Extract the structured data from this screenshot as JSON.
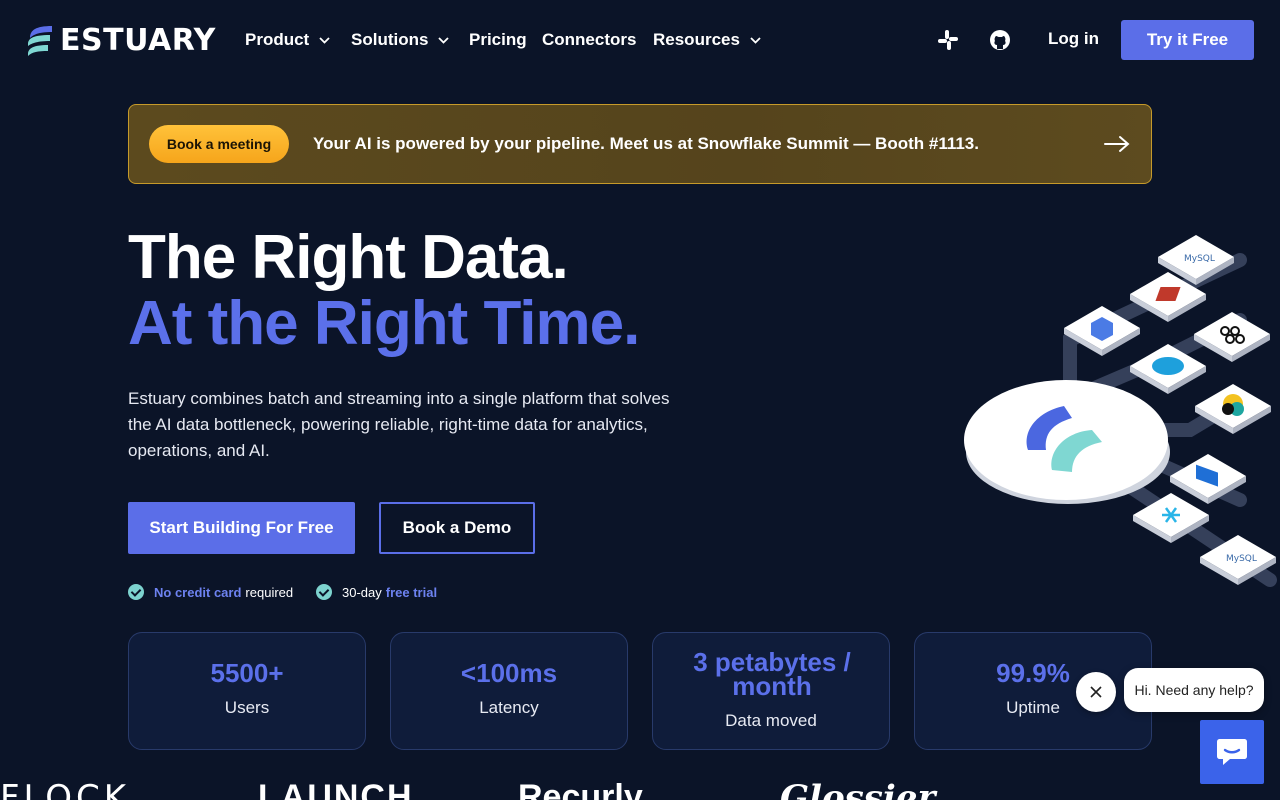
{
  "brand": {
    "name": "ESTUARY"
  },
  "nav": {
    "items": [
      {
        "label": "Product",
        "has_dropdown": true
      },
      {
        "label": "Solutions",
        "has_dropdown": true
      },
      {
        "label": "Pricing",
        "has_dropdown": false
      },
      {
        "label": "Connectors",
        "has_dropdown": false
      },
      {
        "label": "Resources",
        "has_dropdown": true
      }
    ],
    "icons": [
      "slack-icon",
      "github-icon"
    ],
    "login": "Log in",
    "cta": "Try it Free"
  },
  "banner": {
    "button": "Book a meeting",
    "text": "Your AI is powered by your pipeline. Meet us at Snowflake Summit — Booth #1113.",
    "icon": "arrow-right-icon"
  },
  "hero": {
    "title_line1": "The Right Data.",
    "title_line2": "At the Right Time.",
    "description": "Estuary combines batch and streaming into a single platform that solves the AI data bottleneck, powering reliable, right-time data for analytics, operations, and AI.",
    "primary_cta": "Start Building For Free",
    "secondary_cta": "Book a Demo",
    "perks": [
      {
        "highlight": "No credit card",
        "rest": "required",
        "order": "highlight-first"
      },
      {
        "lead": "30-day",
        "highlight": "free trial",
        "order": "highlight-last"
      }
    ]
  },
  "stats": [
    {
      "value": "5500+",
      "label": "Users"
    },
    {
      "value": "<100ms",
      "label": "Latency"
    },
    {
      "value": "3 petabytes / month",
      "label": "Data moved"
    },
    {
      "value": "99.9%",
      "label": "Uptime"
    }
  ],
  "chat": {
    "greeting": "Hi. Need any help?"
  },
  "logo_strip": [
    "FLOCK",
    "LAUNCH",
    "Recurly",
    "Glossier"
  ],
  "colors": {
    "background": "#0b1428",
    "accent": "#5b6ee8",
    "accent_text": "#5b70ea",
    "banner_border": "#c69a2a",
    "banner_button": "#ffc23a",
    "check": "#7dd3cf",
    "chat_button": "#3b63ea"
  }
}
